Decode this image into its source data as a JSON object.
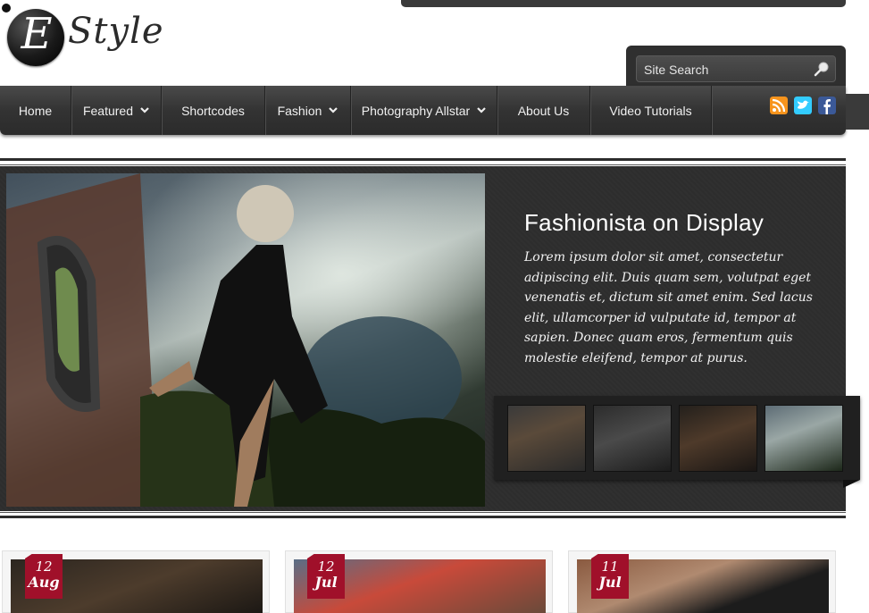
{
  "header": {
    "logo_letter": "E",
    "logo_word": "Style",
    "search": {
      "placeholder": "Site Search"
    }
  },
  "nav": {
    "items": [
      {
        "label": "Home",
        "dropdown": false
      },
      {
        "label": "Featured",
        "dropdown": true
      },
      {
        "label": "Shortcodes",
        "dropdown": false
      },
      {
        "label": "Fashion",
        "dropdown": true
      },
      {
        "label": "Photography Allstar",
        "dropdown": true
      },
      {
        "label": "About Us",
        "dropdown": false
      },
      {
        "label": "Video Tutorials",
        "dropdown": false
      }
    ],
    "social_icons": [
      "rss-icon",
      "twitter-icon",
      "facebook-icon"
    ]
  },
  "featured": {
    "title": "Fashionista on Display",
    "excerpt": "Lorem ipsum dolor sit amet, consectetur adipiscing elit. Duis quam sem, volutpat eget venenatis et, dictum sit amet enim. Sed lacus elit, ullamcorper id vulputate id, tempor at sapien. Donec quam eros, fermentum quis molestie eleifend, tempor at purus.",
    "thumbnail_count": 4
  },
  "posts": [
    {
      "day": "12",
      "month": "Aug"
    },
    {
      "day": "12",
      "month": "Jul"
    },
    {
      "day": "11",
      "month": "Jul"
    }
  ],
  "colors": {
    "accent": "#a0102a",
    "nav_bg": "#333333",
    "slider_bg": "#2d2d2d",
    "rss": "#f7941d",
    "twitter": "#33ccff",
    "facebook": "#3b5998"
  }
}
